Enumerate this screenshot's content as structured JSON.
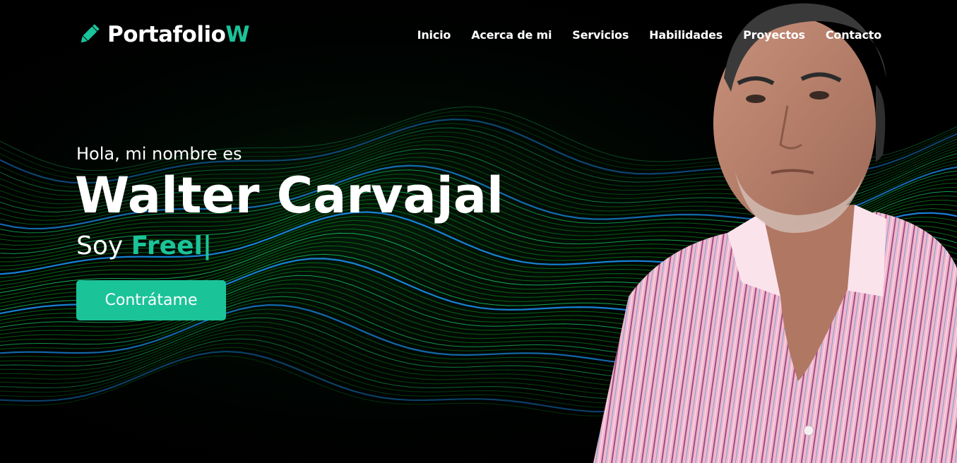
{
  "brand": {
    "name": "Portafolio",
    "accent_letter": "W",
    "icon": "pencil-icon",
    "accent_color": "#1bc399"
  },
  "nav": {
    "items": [
      {
        "label": "Inicio"
      },
      {
        "label": "Acerca de mi"
      },
      {
        "label": "Servicios"
      },
      {
        "label": "Habilidades"
      },
      {
        "label": "Proyectos"
      },
      {
        "label": "Contacto"
      }
    ]
  },
  "hero": {
    "greeting": "Hola, mi nombre es",
    "name": "Walter Carvajal",
    "role_prefix": "Soy",
    "role_typed": "Freel",
    "cursor": "|",
    "cta_label": "Contrátame",
    "background_colors": [
      "#0a7a1a",
      "#1a9cff",
      "#17c964"
    ]
  }
}
